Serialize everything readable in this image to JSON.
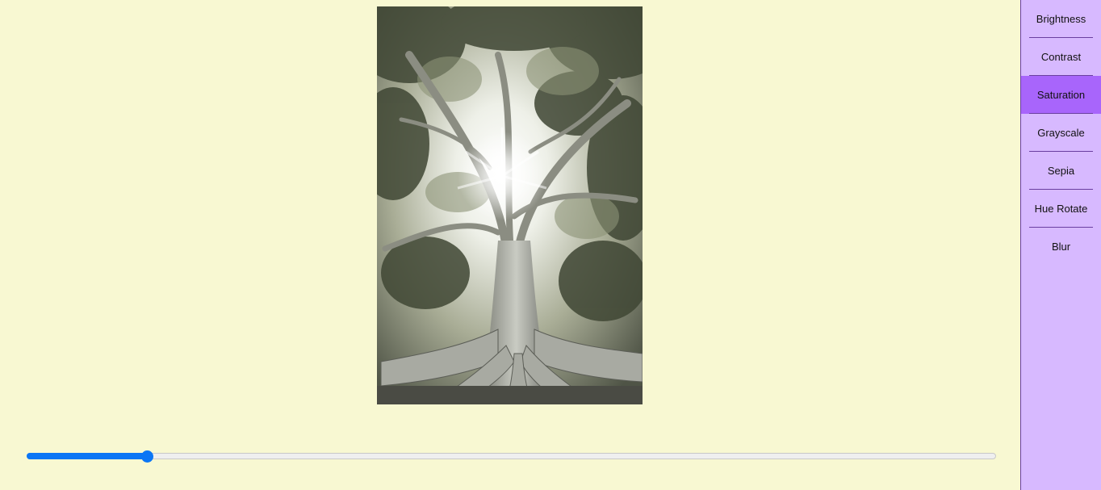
{
  "filters": [
    {
      "label": "Brightness",
      "active": false
    },
    {
      "label": "Contrast",
      "active": false
    },
    {
      "label": "Saturation",
      "active": true
    },
    {
      "label": "Grayscale",
      "active": false
    },
    {
      "label": "Sepia",
      "active": false
    },
    {
      "label": "Hue Rotate",
      "active": false
    },
    {
      "label": "Blur",
      "active": false
    }
  ],
  "slider": {
    "fraction": 0.124
  },
  "colors": {
    "background": "#f8f8d2",
    "sidebar": "#d7b9ff",
    "active": "#a865fb",
    "slider_accent": "#0b76f5"
  },
  "image": {
    "subject": "tree with sun through branches"
  }
}
